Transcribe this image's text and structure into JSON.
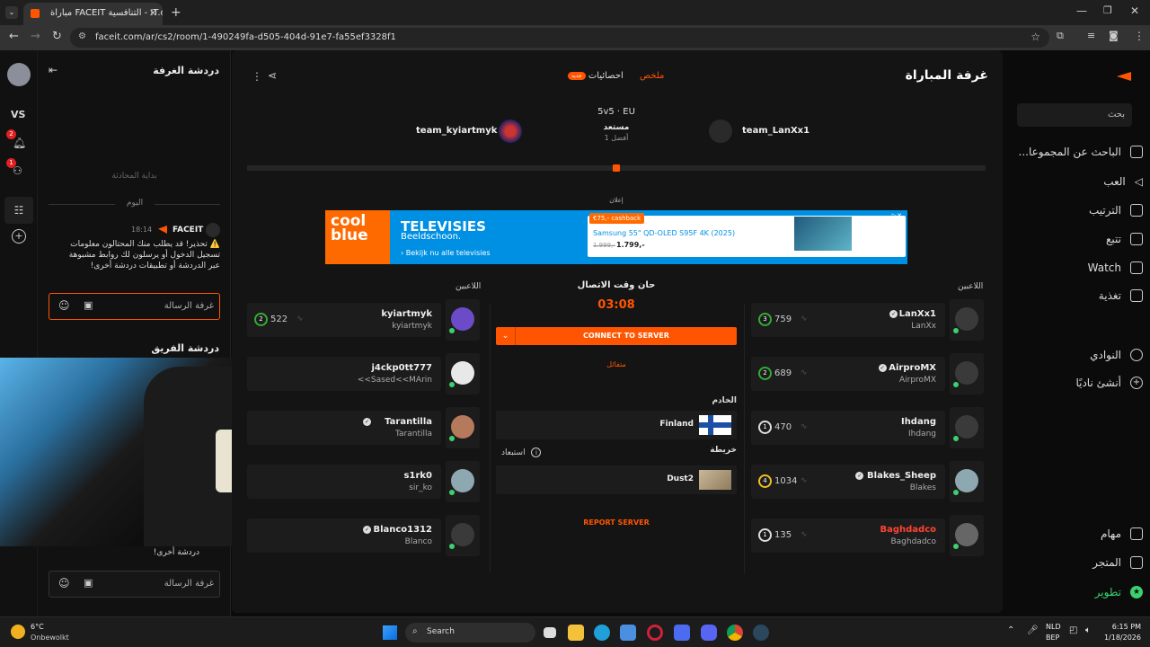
{
  "browser": {
    "tab_title": "مباراة FACEIT التنافسية - IT.com",
    "url": "faceit.com/ar/cs2/room/1-490249fa-d505-404d-91e7-fa55ef3328f1"
  },
  "rail": {
    "vs_label": "VS",
    "badge1": "2",
    "badge2": "1"
  },
  "chat": {
    "room_title": "دردشة الغرفة",
    "start_label": "بداية المحادثة",
    "today_label": "اليوم",
    "sender": "FACEIT",
    "time": "18:14",
    "message": "⚠️ تحذير! قد يطلب منك المحتالون معلومات تسجيل الدخول أو يرسلون لك روابط مشبوهة عبر الدردشة أو تطبيقات دردشة أخرى!",
    "input_placeholder": "غرفة الرسالة",
    "team_title": "دردشة الفريق",
    "team_message_tail": "دردشة أخرى!",
    "team_input_placeholder": "غرفة الرسالة"
  },
  "header": {
    "title": "غرفة المباراة",
    "tab_summary": "ملخص",
    "tab_stats": "احصائيات",
    "tab_stats_badge": "جديد"
  },
  "match": {
    "mode": "5v5 · EU",
    "status": "مستعد",
    "best_of": "أفضل 1",
    "team_left": "team_kyiartmyk",
    "team_right": "team_LanXx1",
    "progress": 0.5
  },
  "ad": {
    "label": "إعلان",
    "brand_line1": "cool",
    "brand_line2": "blue",
    "headline": "TELEVISIES",
    "subline": "Beeldschoon.",
    "link": "› Bekijk nu alle televisies",
    "cashback": "€75,- cashback",
    "product": "Samsung 55\" QD-OLED S95F 4K (2025)",
    "old_price": "1.999,-",
    "new_price": "1.799,-"
  },
  "center": {
    "players_label_left": "اللاعبين",
    "players_label_right": "اللاعبين",
    "connect_time_label": "حان وقت الاتصال",
    "timer": "03:08",
    "connect_button": "CONNECT TO SERVER",
    "state": "متفائل",
    "server_label": "الخادم",
    "server_name": "Finland",
    "map_label": "خريطة",
    "exclude_label": "استبعاد",
    "map_name": "Dust2",
    "report_label": "REPORT SERVER"
  },
  "team_left_players": [
    {
      "name": "kyiartmyk",
      "sub": "kyiartmyk",
      "elo": "522",
      "level": "2",
      "verified": false
    },
    {
      "name": "j4ckp0tt777",
      "sub": "<<Sased<<MArin",
      "elo": "",
      "level": "",
      "verified": false
    },
    {
      "name": "Tarantilla",
      "sub": "Tarantilla",
      "elo": "",
      "level": "",
      "verified": true
    },
    {
      "name": "s1rk0",
      "sub": "sir_ko",
      "elo": "",
      "level": "",
      "verified": false
    },
    {
      "name": "Blanco1312",
      "sub": "Blanco",
      "elo": "",
      "level": "",
      "verified": true
    }
  ],
  "team_right_players": [
    {
      "name": "LanXx1",
      "sub": "LanXx",
      "elo": "759",
      "level": "3",
      "verified": true
    },
    {
      "name": "AirproMX",
      "sub": "AirproMX",
      "elo": "689",
      "level": "2",
      "verified": true
    },
    {
      "name": "Ihdang",
      "sub": "Ihdang",
      "elo": "470",
      "level": "1",
      "verified": false
    },
    {
      "name": "Blakes_Sheep",
      "sub": "Blakes",
      "elo": "1034",
      "level": "4",
      "verified": true
    },
    {
      "name": "Baghdadco",
      "sub": "Baghdadco",
      "elo": "135",
      "level": "1",
      "verified": false
    }
  ],
  "nav": {
    "search": "بحث",
    "items": [
      "الباحث عن المجموعا...",
      "العب",
      "الترتيب",
      "تتبع",
      "Watch",
      "تغذية"
    ],
    "clubs": "النوادي",
    "create_club": "أنشئ ناديًا",
    "tasks": "مهام",
    "store": "المتجر",
    "upgrade": "تطوير"
  },
  "taskbar": {
    "weather_temp": "6°C",
    "weather_desc": "Onbewolkt",
    "search": "Search",
    "lang1": "NLD",
    "lang2": "BEP",
    "time": "6:15 PM",
    "date": "1/18/2026"
  },
  "colors": {
    "accent": "#ff5500",
    "bg": "#141414",
    "card": "#1c1c1c",
    "online": "#3bd16f",
    "red_name": "#ff4433"
  }
}
